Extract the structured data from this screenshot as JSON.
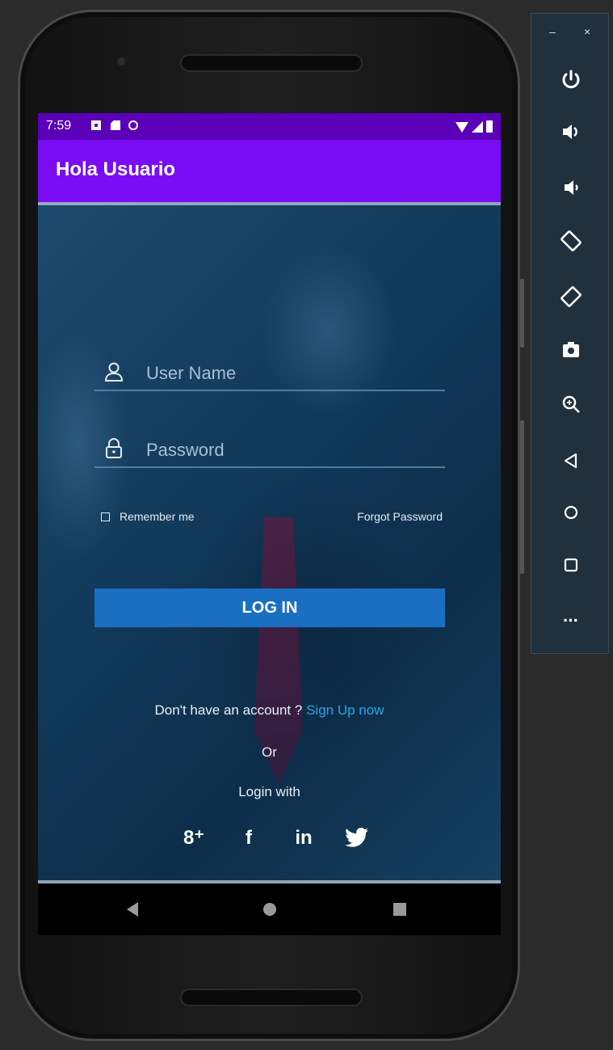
{
  "statusbar": {
    "time": "7:59"
  },
  "appbar": {
    "title": "Hola Usuario"
  },
  "form": {
    "username_placeholder": "User Name",
    "password_placeholder": "Password",
    "remember_label": "Remember me",
    "forgot_label": "Forgot Password",
    "login_label": "LOG IN",
    "signup_prefix": "Don't have an account ?",
    "signup_link": "Sign Up now",
    "or_label": "Or",
    "login_with_label": "Login with"
  },
  "social": {
    "google": "8⁺",
    "facebook": "f",
    "linkedin": "in"
  },
  "toolbar": {
    "minimize": "–",
    "close": "×",
    "more": "···",
    "icons": [
      "power-icon",
      "volume-up-icon",
      "volume-down-icon",
      "rotate-left-icon",
      "rotate-right-icon",
      "camera-icon",
      "zoom-icon",
      "back-icon",
      "home-icon",
      "overview-icon",
      "more-icon"
    ]
  },
  "colors": {
    "statusbar": "#5a00b8",
    "appbar": "#7a0cf3",
    "login_button": "#1a6fc2",
    "link": "#2aa6e8"
  }
}
